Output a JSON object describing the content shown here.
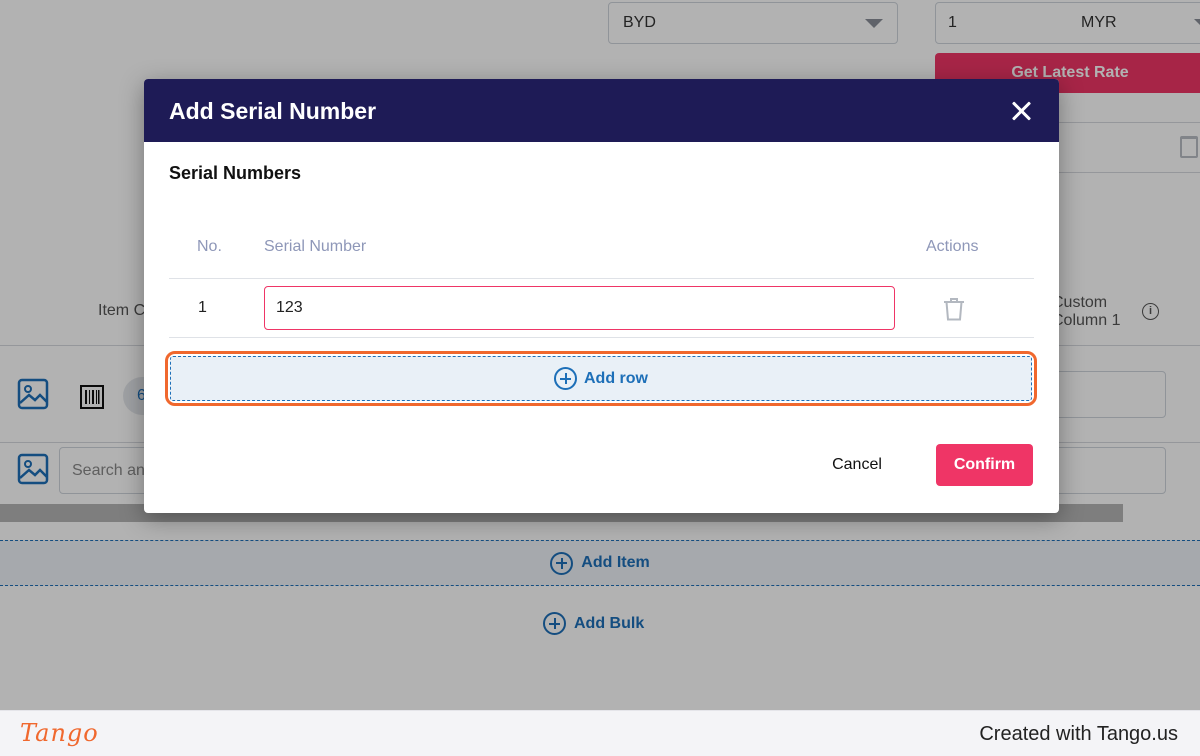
{
  "background": {
    "currency_select": "BYD",
    "rate_amount": "1",
    "rate_currency": "MYR",
    "get_latest_rate": "Get Latest Rate",
    "item_label_partial": "Item C",
    "custom_column_line1": "Custom",
    "custom_column_line2": "Column 1",
    "pill_partial": "6",
    "search_placeholder_partial": "Search an",
    "add_item": "Add Item",
    "add_bulk": "Add Bulk"
  },
  "dialog": {
    "title": "Add Serial Number",
    "section_title": "Serial Numbers",
    "table": {
      "columns": [
        "No.",
        "Serial Number",
        "Actions"
      ],
      "rows": [
        {
          "no": "1",
          "serial_number": "123"
        }
      ]
    },
    "add_row": "Add row",
    "cancel": "Cancel",
    "confirm": "Confirm"
  },
  "footer": {
    "logo": "Tango",
    "credit": "Created with Tango.us"
  },
  "colors": {
    "header_navy": "#1e1b56",
    "accent_pink": "#ef3566",
    "link_blue": "#1d6fb8",
    "highlight_orange": "#f0682e"
  }
}
